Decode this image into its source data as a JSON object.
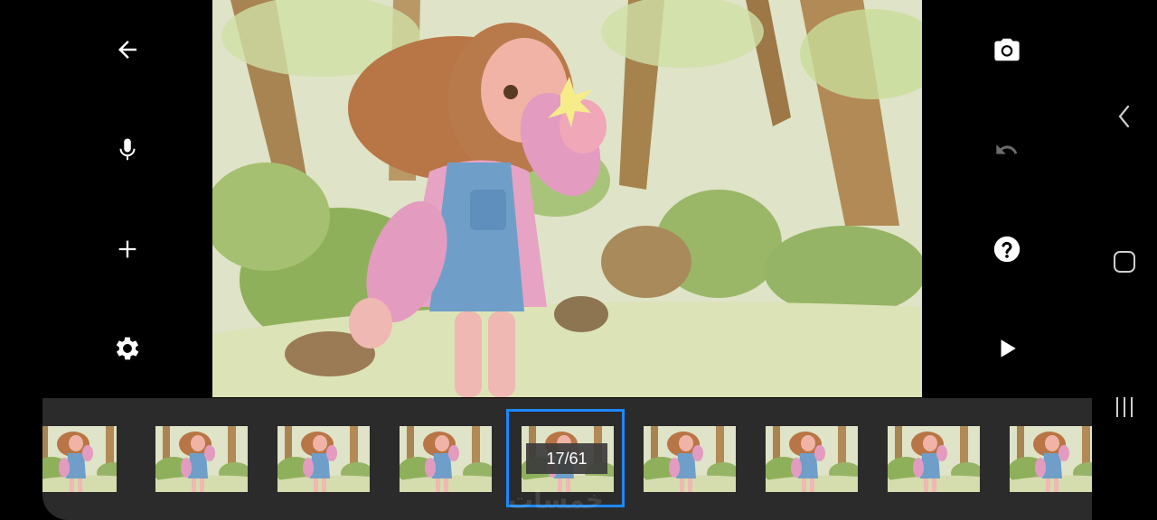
{
  "left_toolbar": {
    "back": {
      "icon": "arrow-left-icon"
    },
    "record_audio": {
      "icon": "microphone-icon"
    },
    "add": {
      "icon": "plus-icon"
    },
    "settings": {
      "icon": "gear-icon"
    }
  },
  "right_toolbar": {
    "capture": {
      "icon": "camera-icon"
    },
    "undo": {
      "icon": "undo-icon",
      "enabled": false
    },
    "help": {
      "icon": "help-icon"
    },
    "play": {
      "icon": "play-icon"
    }
  },
  "android_nav": {
    "back": {
      "icon": "chevron-left-icon"
    },
    "home": {
      "icon": "rounded-square-icon"
    },
    "recents": {
      "icon": "three-bars-icon"
    }
  },
  "filmstrip": {
    "frame_counter": "17/61",
    "selected_index": 4,
    "visible_thumbnails": 9,
    "watermark": "خمسات"
  },
  "colors": {
    "background": "#000000",
    "filmstrip_bg": "#2b2b2b",
    "selection_accent": "#1e88ff",
    "icon_disabled": "#6b6b6b"
  }
}
